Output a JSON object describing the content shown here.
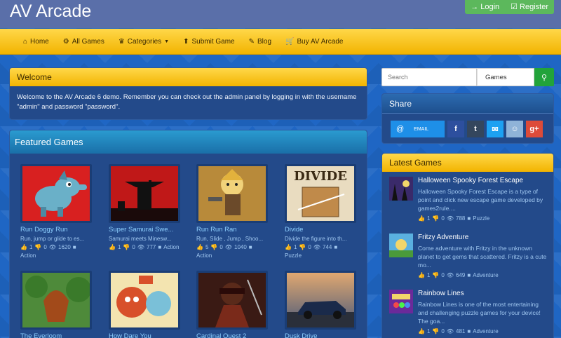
{
  "site": {
    "title": "AV Arcade"
  },
  "auth": {
    "login": "Login",
    "register": "Register"
  },
  "nav": [
    {
      "icon": "home-icon",
      "label": "Home"
    },
    {
      "icon": "gear-icon",
      "label": "All Games"
    },
    {
      "icon": "crown-icon",
      "label": "Categories"
    },
    {
      "icon": "upload-icon",
      "label": "Submit Game"
    },
    {
      "icon": "pencil-icon",
      "label": "Blog"
    },
    {
      "icon": "cart-icon",
      "label": "Buy AV Arcade"
    }
  ],
  "welcome": {
    "title": "Welcome",
    "text": "Welcome to the AV Arcade 6 demo. Remember you can check out the admin panel by logging in with the username \"admin\" and password \"password\"."
  },
  "featured": {
    "title": "Featured Games",
    "games": [
      {
        "title": "Run Doggy Run",
        "desc": "Run, jump or glide to es...",
        "likes": "1",
        "dislikes": "0",
        "views": "1620",
        "category": "Action"
      },
      {
        "title": "Super Samurai Swe...",
        "desc": "Samurai meets Minesw...",
        "likes": "1",
        "dislikes": "0",
        "views": "777",
        "category": "Action"
      },
      {
        "title": "Run Run Ran",
        "desc": "Run, Slide , Jump , Shoo...",
        "likes": "5",
        "dislikes": "0",
        "views": "1040",
        "category": "Action"
      },
      {
        "title": "Divide",
        "desc": "Divide the figure into th...",
        "likes": "1",
        "dislikes": "0",
        "views": "744",
        "category": "Puzzle"
      },
      {
        "title": "The Everloom"
      },
      {
        "title": "How Dare You"
      },
      {
        "title": "Cardinal Quest 2"
      },
      {
        "title": "Dusk Drive"
      }
    ]
  },
  "search": {
    "placeholder": "Search",
    "type": "Games"
  },
  "share": {
    "title": "Share",
    "email": "EMAIL"
  },
  "latest": {
    "title": "Latest Games",
    "games": [
      {
        "title": "Halloween Spooky Forest Escape",
        "desc": "Halloween Spooky Forest Escape is a type of point and click new escape game developed by games2rule....",
        "likes": "1",
        "dislikes": "0",
        "views": "788",
        "category": "Puzzle"
      },
      {
        "title": "Fritzy Adventure",
        "desc": "Come adventure with Fritzy in the unknown planet to get gems that scattered. Fritzy is a cute mo...",
        "likes": "1",
        "dislikes": "0",
        "views": "649",
        "category": "Adventure"
      },
      {
        "title": "Rainbow Lines",
        "desc": "Rainbow Lines is one of the most entertaining and challenging puzzle games for your device! The goa...",
        "likes": "1",
        "dislikes": "0",
        "views": "481",
        "category": "Adventure"
      }
    ]
  },
  "thumb_art": {
    "divide_logo": "DIVIDE"
  },
  "colors": {
    "accent_yellow": "#f2b400",
    "nav_blue": "#5a6fa9",
    "login_green": "#5cb85c",
    "search_green": "#22a33a"
  }
}
